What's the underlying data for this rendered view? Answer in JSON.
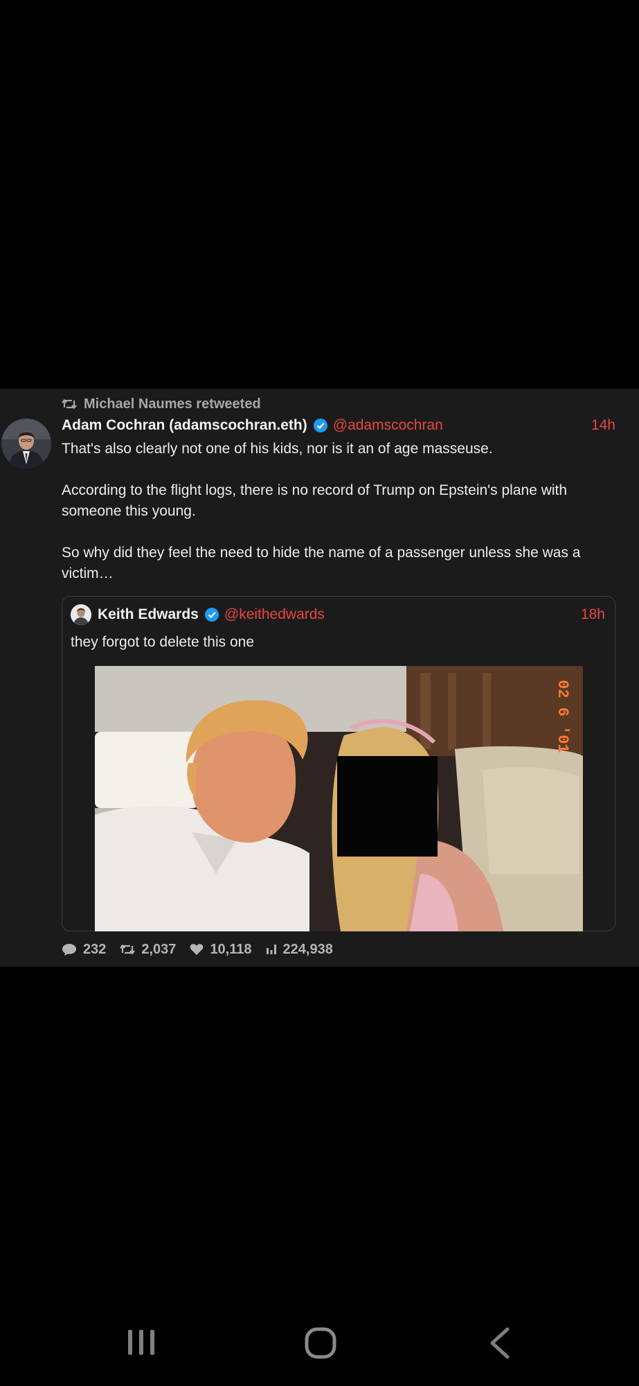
{
  "retweet": {
    "text": "Michael Naumes retweeted",
    "icon": "retweet-icon"
  },
  "tweet": {
    "display_name": "Adam Cochran (adamscochran.eth)",
    "handle": "@adamscochran",
    "time": "14h",
    "verified_icon": "verified-badge-icon",
    "paragraphs": [
      "That's also clearly not one of his kids, nor is it an of age masseuse.",
      "According to the flight logs, there is no record of Trump on Epstein's plane with someone this young.",
      "So why did they feel the need to hide the name of a passenger unless she was a victim…"
    ]
  },
  "quoted": {
    "display_name": "Keith Edwards",
    "handle": "@keithedwards",
    "time": "18h",
    "text": "they forgot to delete this one",
    "photo_date_stamp": "02 6 '01"
  },
  "stats": {
    "replies": "232",
    "retweets": "2,037",
    "likes": "10,118",
    "views": "224,938"
  },
  "colors": {
    "accent": "#e8473f",
    "card_background": "#1b1b1c",
    "page_background": "#000000",
    "verified": "#1d9bf0"
  },
  "nav": {
    "icons": [
      "recent-apps-icon",
      "home-icon",
      "back-icon"
    ]
  }
}
